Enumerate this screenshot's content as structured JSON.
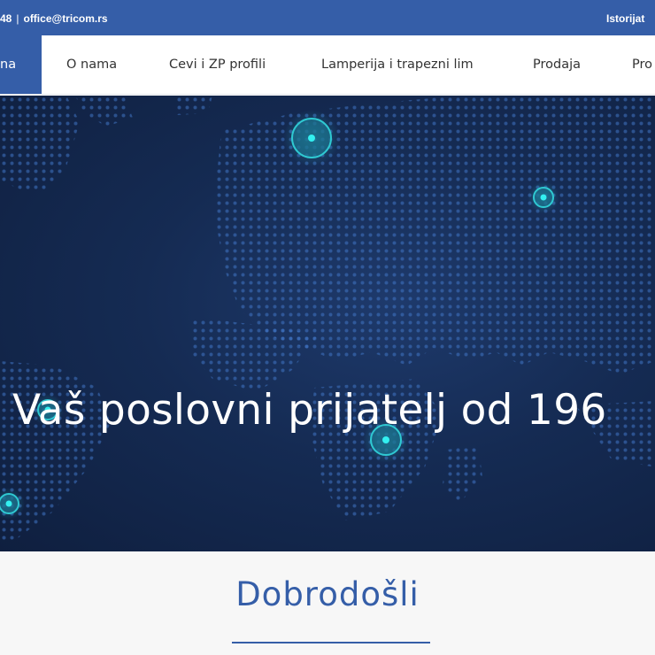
{
  "topbar": {
    "phone": "48",
    "separator": "|",
    "email": "office@tricom.rs",
    "history_link": "Istorijat"
  },
  "nav": {
    "items": [
      {
        "label": "na",
        "active": true
      },
      {
        "label": "O nama"
      },
      {
        "label": "Cevi i ZP profili"
      },
      {
        "label": "Lamperija i trapezni lim"
      },
      {
        "label": "Prodaja"
      },
      {
        "label": "Pro"
      }
    ]
  },
  "hero": {
    "title": "Vaš poslovni prijatelj od 196"
  },
  "welcome": {
    "title": "Dobrodošli"
  },
  "colors": {
    "brand_blue": "#355ea8",
    "hero_dark": "#152b53",
    "marker_cyan": "#2fe6e6"
  },
  "icons": {
    "map_markers": "location-pin-icon"
  }
}
